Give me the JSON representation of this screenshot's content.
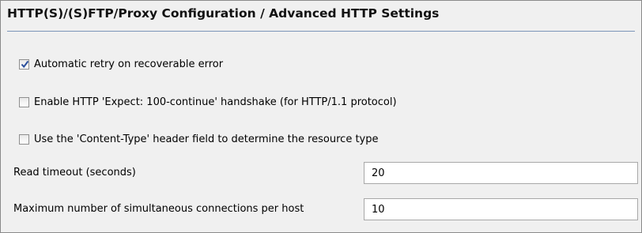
{
  "section": {
    "title": "HTTP(S)/(S)FTP/Proxy Configuration / Advanced HTTP Settings"
  },
  "options": [
    {
      "label": "Automatic retry on recoverable error",
      "checked": true
    },
    {
      "label": "Enable HTTP 'Expect: 100-continue' handshake (for HTTP/1.1 protocol)",
      "checked": false
    },
    {
      "label": "Use the 'Content-Type' header field to determine the resource type",
      "checked": false
    }
  ],
  "fields": {
    "read_timeout": {
      "label": "Read timeout (seconds)",
      "value": "20"
    },
    "max_connections": {
      "label": "Maximum number of simultaneous connections per host",
      "value": "10"
    }
  },
  "colors": {
    "background": "#f0f0f0",
    "title_rule": "#7c95b8",
    "checkmark": "#2a4f9c"
  }
}
